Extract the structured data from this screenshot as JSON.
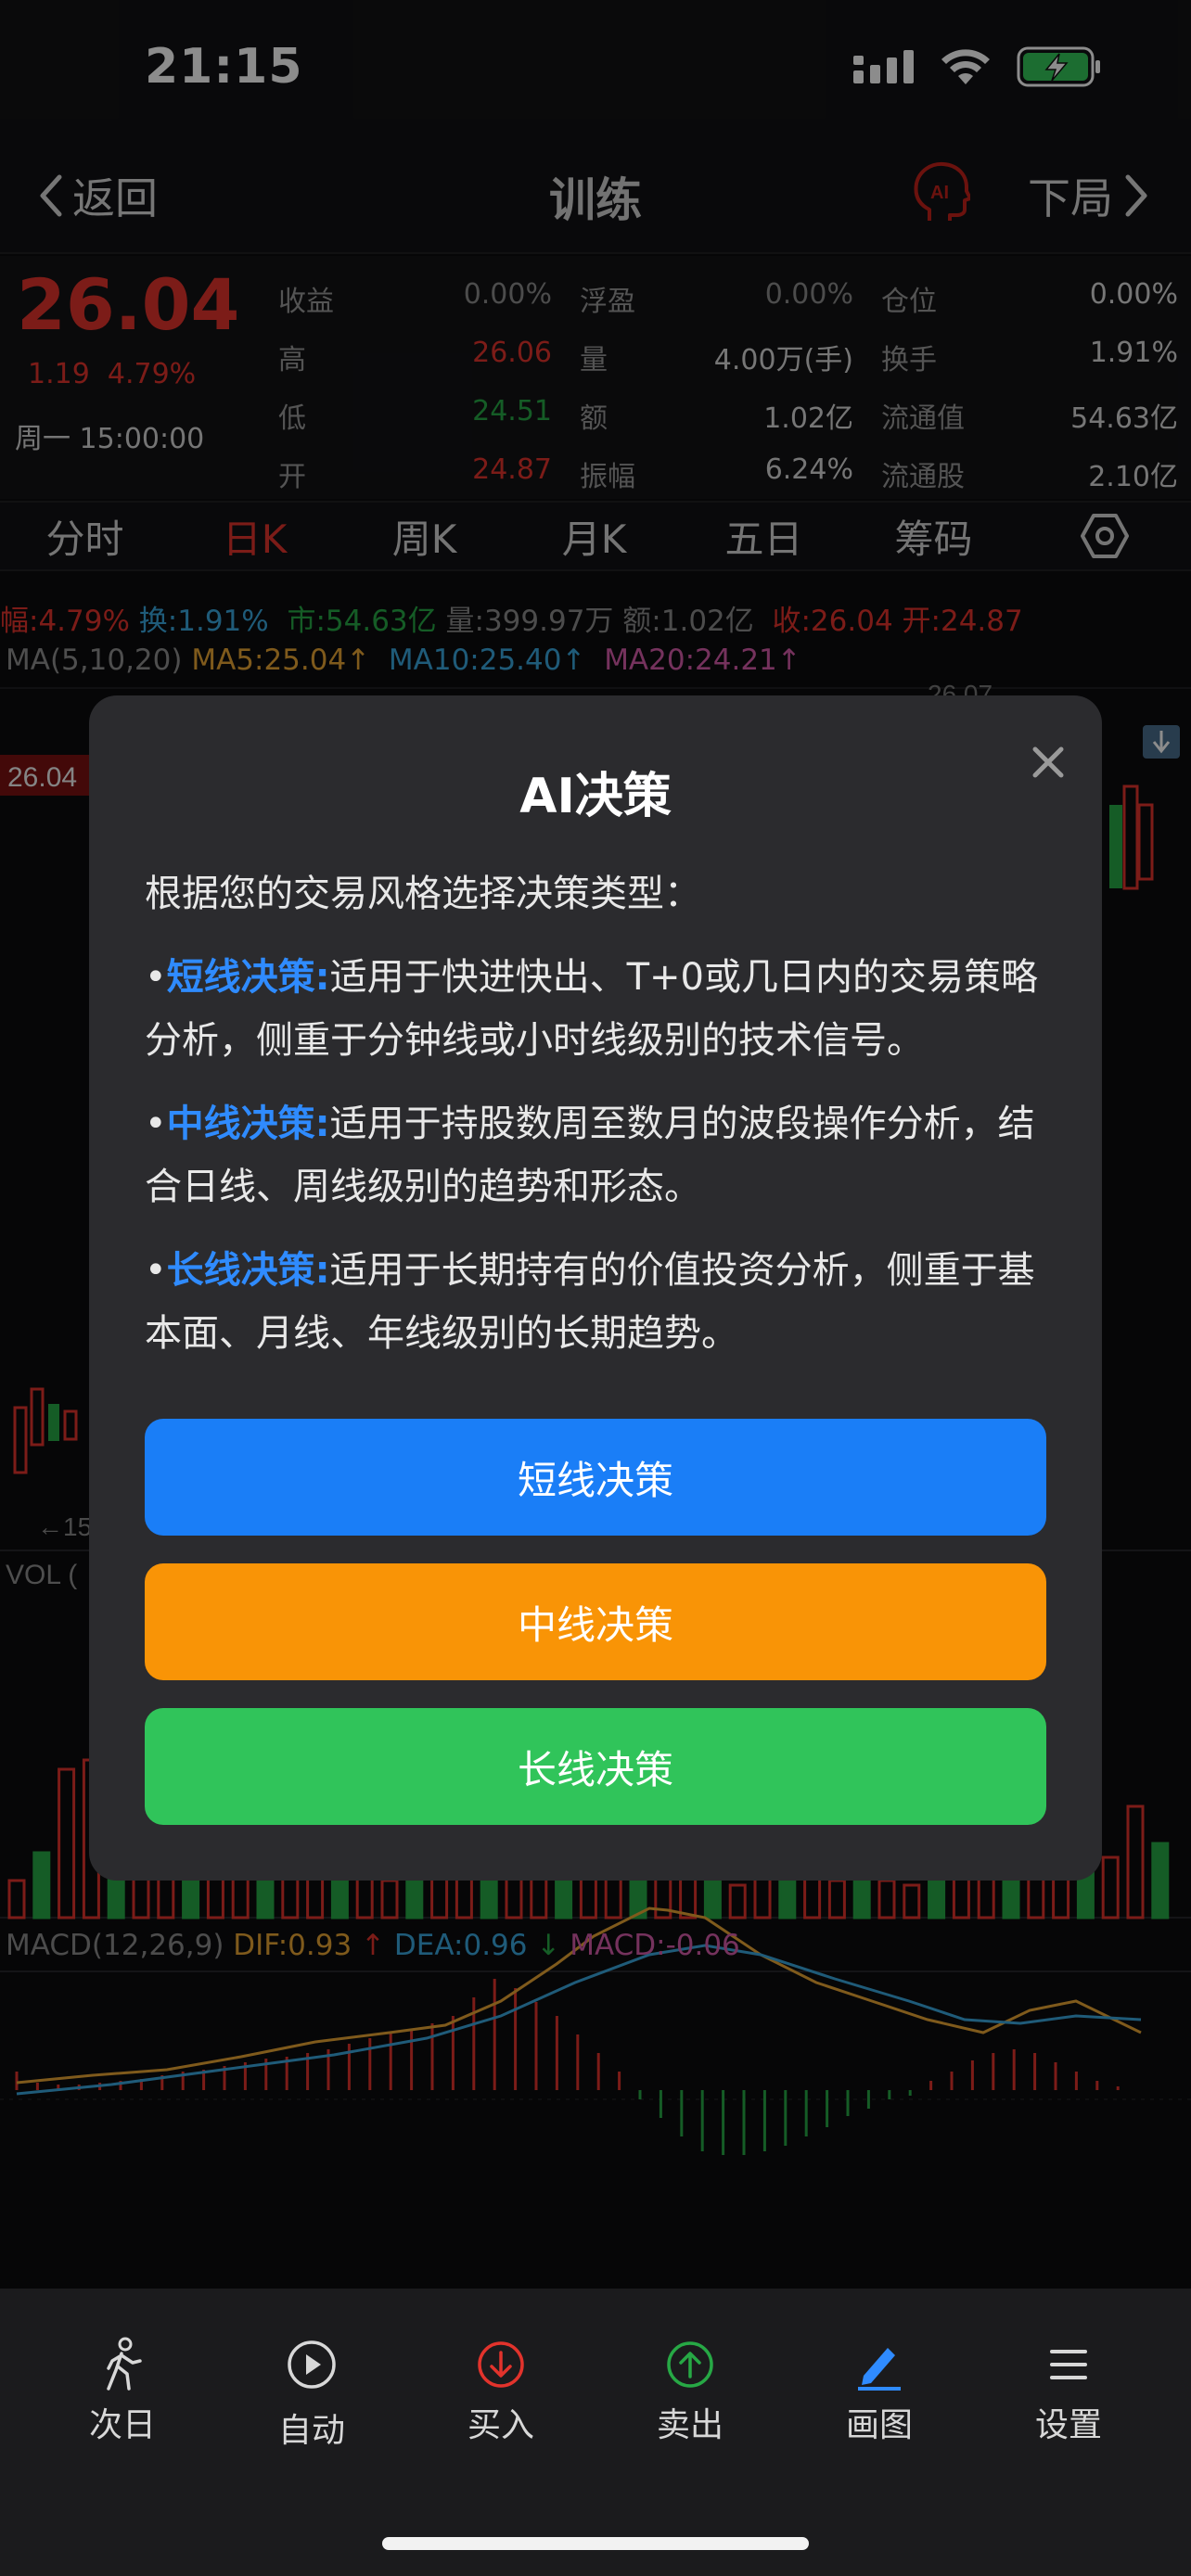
{
  "status_bar": {
    "time": "21:15"
  },
  "nav": {
    "back_label": "返回",
    "title": "训练",
    "ai_badge": "AI",
    "next_label": "下局"
  },
  "quote": {
    "price": "26.04",
    "change": "1.19",
    "change_pct": "4.79%",
    "datetime": "周一 15:00:00",
    "rows": [
      [
        {
          "label": "收益",
          "value": "0.00%",
          "color": "grey"
        },
        {
          "label": "浮盈",
          "value": "0.00%",
          "color": "grey"
        },
        {
          "label": "仓位",
          "value": "0.00%",
          "color": "plain"
        }
      ],
      [
        {
          "label": "高",
          "value": "26.06",
          "color": "red"
        },
        {
          "label": "量",
          "value": "4.00万(手)",
          "color": "plain"
        },
        {
          "label": "换手",
          "value": "1.91%",
          "color": "plain"
        }
      ],
      [
        {
          "label": "低",
          "value": "24.51",
          "color": "green"
        },
        {
          "label": "额",
          "value": "1.02亿",
          "color": "plain"
        },
        {
          "label": "流通值",
          "value": "54.63亿",
          "color": "plain"
        }
      ],
      [
        {
          "label": "开",
          "value": "24.87",
          "color": "red"
        },
        {
          "label": "振幅",
          "value": "6.24%",
          "color": "plain"
        },
        {
          "label": "流通股",
          "value": "2.10亿",
          "color": "plain"
        }
      ]
    ]
  },
  "tabs": [
    {
      "label": "分时",
      "active": false
    },
    {
      "label": "日K",
      "active": true
    },
    {
      "label": "周K",
      "active": false
    },
    {
      "label": "月K",
      "active": false
    },
    {
      "label": "五日",
      "active": false
    },
    {
      "label": "筹码",
      "active": false
    }
  ],
  "chart": {
    "info": {
      "amp": "幅:4.79%",
      "turnover": "换:1.91%",
      "mktcap": "市:54.63亿",
      "volume": "量:399.97万",
      "amount": "额:1.02亿",
      "close": "收:26.04",
      "open": "开:24.87"
    },
    "ma": {
      "label": "MA(5,10,20)",
      "ma5": "MA5:25.04↑",
      "ma10": "MA10:25.40↑",
      "ma20": "MA20:24.21↑"
    },
    "price_tag": "26.04",
    "top_price": "26.07",
    "vol_label": "VOL (",
    "arrow_left": "←15",
    "macd": {
      "label": "MACD(12,26,9)",
      "dif": "DIF:0.93",
      "dif_arrow": "↑",
      "dea": "DEA:0.96",
      "dea_arrow": "↓",
      "macd": "MACD:-0.06"
    },
    "colors": {
      "up": "#e2332c",
      "down": "#27a845",
      "dif": "#e7a534",
      "dea": "#3aa6dc"
    }
  },
  "modal": {
    "title": "AI决策",
    "intro": "根据您的交易风格选择决策类型：",
    "items": [
      {
        "bullet": "•",
        "name": "短线决策:",
        "text": "适用于快进快出、T+0或几日内的交易策略分析，侧重于分钟线或小时线级别的技术信号。"
      },
      {
        "bullet": "•",
        "name": "中线决策:",
        "text": "适用于持股数周至数月的波段操作分析，结合日线、周线级别的趋势和形态。"
      },
      {
        "bullet": "•",
        "name": "长线决策:",
        "text": "适用于长期持有的价值投资分析，侧重于基本面、月线、年线级别的长期趋势。"
      }
    ],
    "buttons": {
      "short": "短线决策",
      "mid": "中线决策",
      "long": "长线决策"
    }
  },
  "bottom_bar": [
    {
      "label": "次日",
      "icon": "walking-person-icon"
    },
    {
      "label": "自动",
      "icon": "play-circle-icon"
    },
    {
      "label": "买入",
      "icon": "down-arrow-circle-icon"
    },
    {
      "label": "卖出",
      "icon": "up-arrow-circle-icon"
    },
    {
      "label": "画图",
      "icon": "pencil-icon"
    },
    {
      "label": "设置",
      "icon": "menu-lines-icon"
    }
  ]
}
